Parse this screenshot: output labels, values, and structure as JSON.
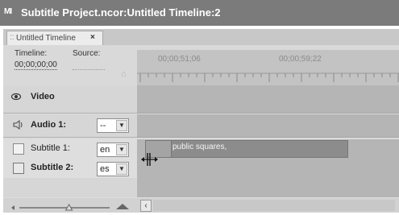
{
  "window": {
    "app_icon": "MI",
    "title": "Subtitle Project.ncor:Untitled Timeline:2"
  },
  "tab": {
    "grip": "::",
    "label": "Untitled Timeline",
    "close": "×"
  },
  "header": {
    "timeline_label": "Timeline:",
    "source_label": "Source:",
    "timecode": "00;00;00;00",
    "ruler_timecodes": [
      "00;00;51;06",
      "00;00;59;22"
    ]
  },
  "tracks": {
    "video": {
      "label": "Video",
      "icon": "eye-icon"
    },
    "audio1": {
      "label": "Audio 1:",
      "select_value": "--",
      "icon": "speaker-icon"
    },
    "subtitle1": {
      "label": "Subtitle 1:",
      "select_value": "en",
      "clip_text": "public squares,"
    },
    "subtitle2": {
      "label": "Subtitle 2:",
      "select_value": "es",
      "icon": "subtitle-track-icon"
    }
  },
  "zoom": {
    "level": 0.55
  },
  "colors": {
    "titlebar": "#7b7b7b",
    "track_area": "#b5b5b5",
    "clip": "#8c8c8c"
  }
}
